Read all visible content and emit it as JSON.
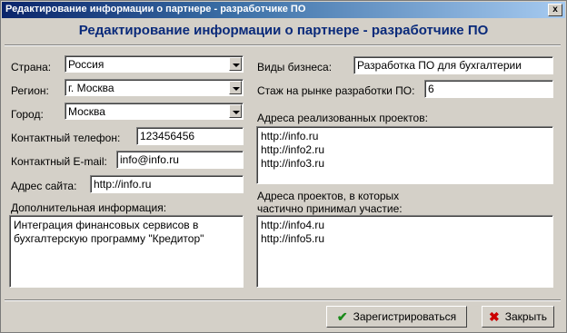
{
  "window": {
    "title": "Редактирование информации о партнере - разработчике ПО",
    "close_glyph": "x"
  },
  "header": {
    "title": "Редактирование информации о партнере - разработчике ПО"
  },
  "left": {
    "country_label": "Страна:",
    "country_value": "Россия",
    "region_label": "Регион:",
    "region_value": "г. Москва",
    "city_label": "Город:",
    "city_value": "Москва",
    "phone_label": "Контактный телефон:",
    "phone_value": "123456456",
    "email_label": "Контактный E-mail:",
    "email_value": "info@info.ru",
    "site_label": "Адрес сайта:",
    "site_value": "http://info.ru",
    "extra_label": "Дополнительная информация:",
    "extra_lines": [
      "Интеграция финансовых сервисов в",
      "бухгалтерскую программу \"Кредитор\""
    ]
  },
  "right": {
    "business_label": "Виды бизнеса:",
    "business_value": "Разработка ПО для бухгалтерии",
    "experience_label": "Стаж на рынке разработки ПО:",
    "experience_value": "6",
    "projects_label": "Адреса реализованных проектов:",
    "projects": [
      "http://info.ru",
      "http://info2.ru",
      "http://info3.ru"
    ],
    "partial_label_1": "Адреса проектов, в которых",
    "partial_label_2": "частично принимал участие:",
    "partial_projects": [
      "http://info4.ru",
      "http://info5.ru"
    ]
  },
  "buttons": {
    "register_label": "Зарегистрироваться",
    "close_label": "Закрыть"
  },
  "icons": {
    "register": "check-icon",
    "close": "cross-icon"
  },
  "colors": {
    "title_bar": "#0a246a",
    "header_text": "#0a2a7a",
    "check": "#1a8a1a",
    "cross": "#cc0000"
  }
}
